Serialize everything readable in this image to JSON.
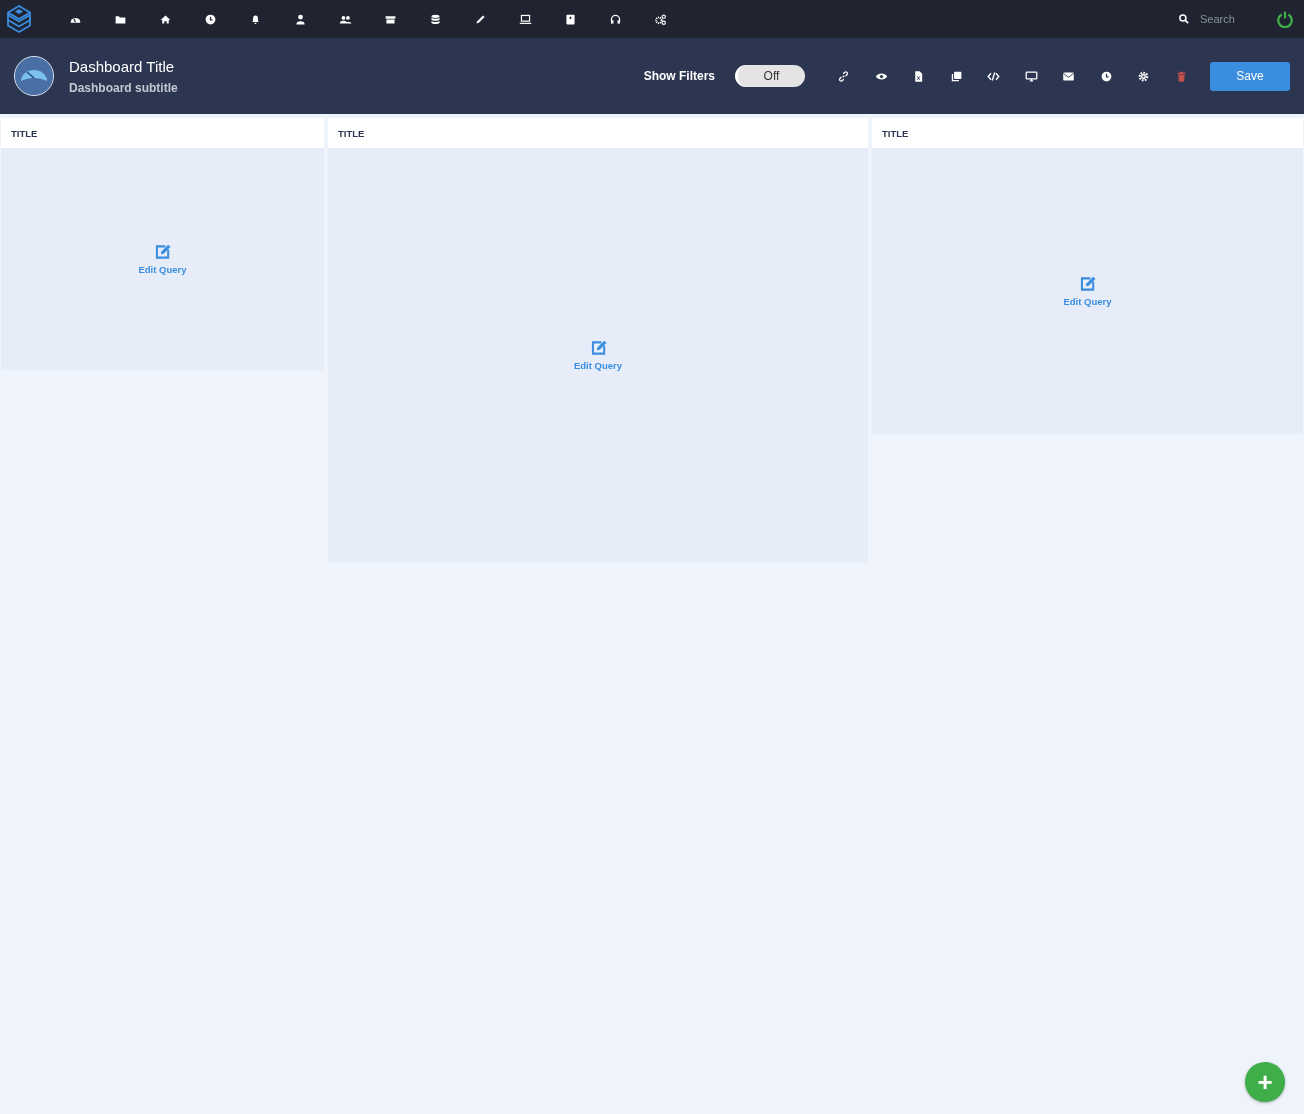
{
  "topbar": {
    "search": {
      "placeholder": "Search"
    }
  },
  "header": {
    "title": "Dashboard Title",
    "subtitle": "Dashboard subtitle",
    "filters": {
      "label": "Show Filters",
      "on": false,
      "state_text": "Off"
    },
    "save": "Save"
  },
  "panels": [
    {
      "title": "TITLE",
      "action": "Edit Query"
    },
    {
      "title": "TITLE",
      "action": "Edit Query"
    },
    {
      "title": "TITLE",
      "action": "Edit Query"
    }
  ],
  "fab": "+"
}
